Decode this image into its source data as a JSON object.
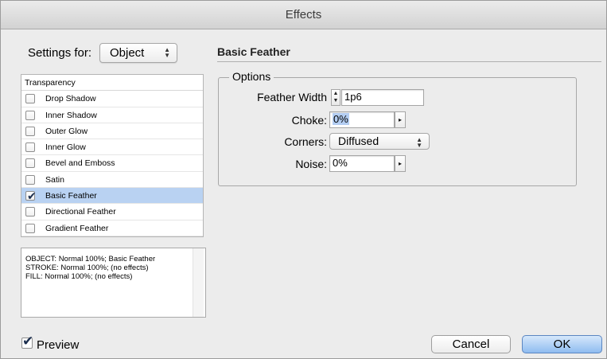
{
  "window": {
    "title": "Effects"
  },
  "settings": {
    "label": "Settings for:",
    "selected": "Object"
  },
  "effects_list": {
    "header": "Transparency",
    "items": [
      {
        "label": "Drop Shadow",
        "checked": false,
        "selected": false
      },
      {
        "label": "Inner Shadow",
        "checked": false,
        "selected": false
      },
      {
        "label": "Outer Glow",
        "checked": false,
        "selected": false
      },
      {
        "label": "Inner Glow",
        "checked": false,
        "selected": false
      },
      {
        "label": "Bevel and Emboss",
        "checked": false,
        "selected": false
      },
      {
        "label": "Satin",
        "checked": false,
        "selected": false
      },
      {
        "label": "Basic Feather",
        "checked": true,
        "selected": true
      },
      {
        "label": "Directional Feather",
        "checked": false,
        "selected": false
      },
      {
        "label": "Gradient Feather",
        "checked": false,
        "selected": false
      }
    ]
  },
  "summary": {
    "lines": [
      "OBJECT: Normal 100%; Basic Feather",
      "STROKE: Normal 100%; (no effects)",
      "FILL: Normal 100%; (no effects)"
    ]
  },
  "panel": {
    "title": "Basic Feather",
    "options_title": "Options",
    "feather_width": {
      "label": "Feather Width",
      "value": "1p6"
    },
    "choke": {
      "label": "Choke:",
      "value": "0%"
    },
    "corners": {
      "label": "Corners:",
      "value": "Diffused"
    },
    "noise": {
      "label": "Noise:",
      "value": "0%"
    }
  },
  "footer": {
    "preview_label": "Preview",
    "preview_checked": true,
    "cancel_label": "Cancel",
    "ok_label": "OK"
  },
  "icons": {
    "checkmark": "✔",
    "updown": "⬍",
    "arrow_right": "▸"
  },
  "colors": {
    "selection": "#b9d2f2",
    "ok_button": "#8fbcf0"
  }
}
